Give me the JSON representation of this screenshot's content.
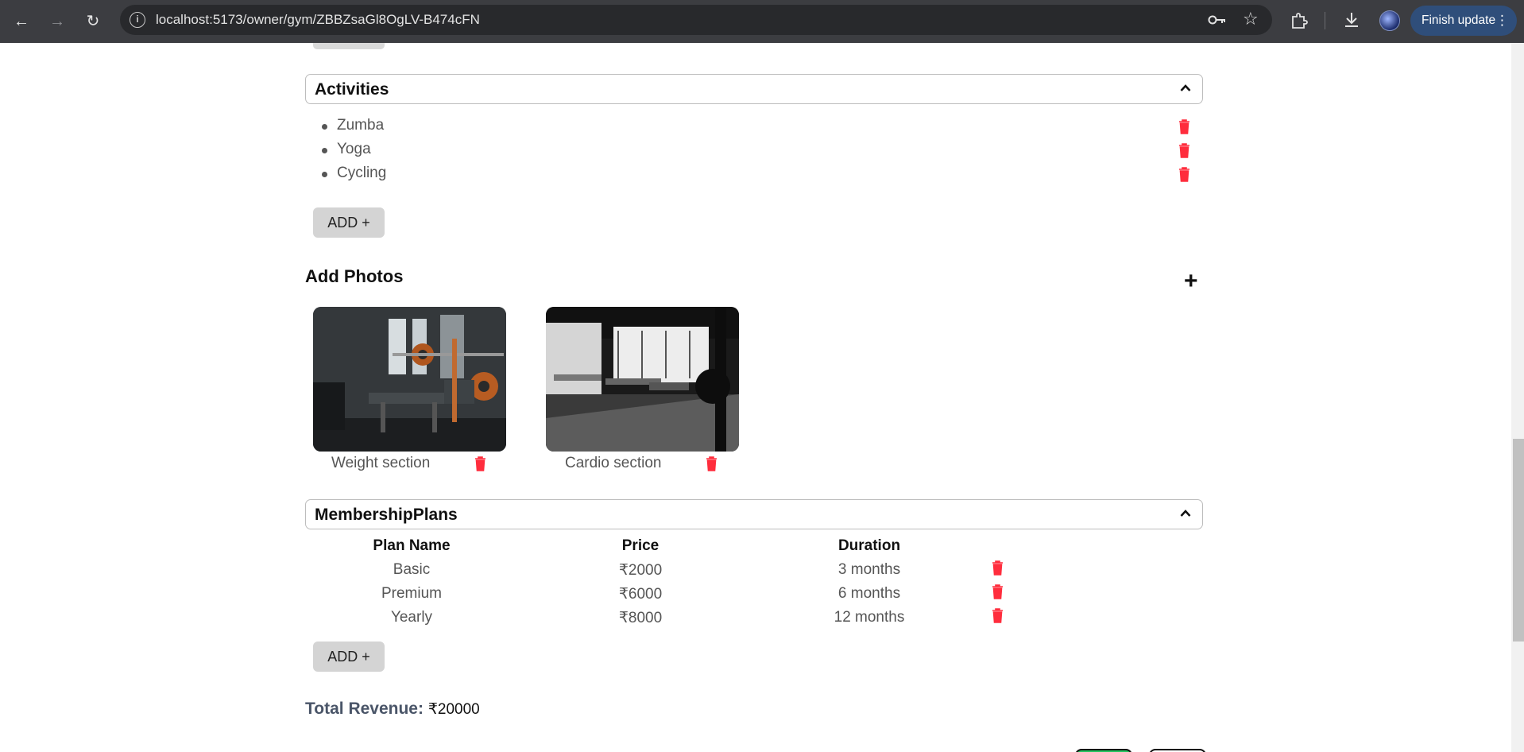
{
  "browser": {
    "url": "localhost:5173/owner/gym/ZBBZsaGl8OgLV-B474cFN",
    "finish_update_label": "Finish update"
  },
  "activities": {
    "title": "Activities",
    "items": [
      "Zumba",
      "Yoga",
      "Cycling"
    ],
    "add_label": "ADD +"
  },
  "photos": {
    "title": "Add Photos",
    "add_icon": "+",
    "items": [
      {
        "caption": "Weight section"
      },
      {
        "caption": "Cardio section"
      }
    ]
  },
  "membership": {
    "title": "MembershipPlans",
    "headers": [
      "Plan Name",
      "Price",
      "Duration"
    ],
    "rows": [
      {
        "name": "Basic",
        "price": "₹2000",
        "duration": "3 months"
      },
      {
        "name": "Premium",
        "price": "₹6000",
        "duration": "6 months"
      },
      {
        "name": "Yearly",
        "price": "₹8000",
        "duration": "12 months"
      }
    ],
    "add_label": "ADD +"
  },
  "revenue": {
    "label": "Total Revenue:",
    "value": "₹20000"
  },
  "colors": {
    "trash": "#ff2d3d",
    "button_bg": "#d4d4d4"
  }
}
